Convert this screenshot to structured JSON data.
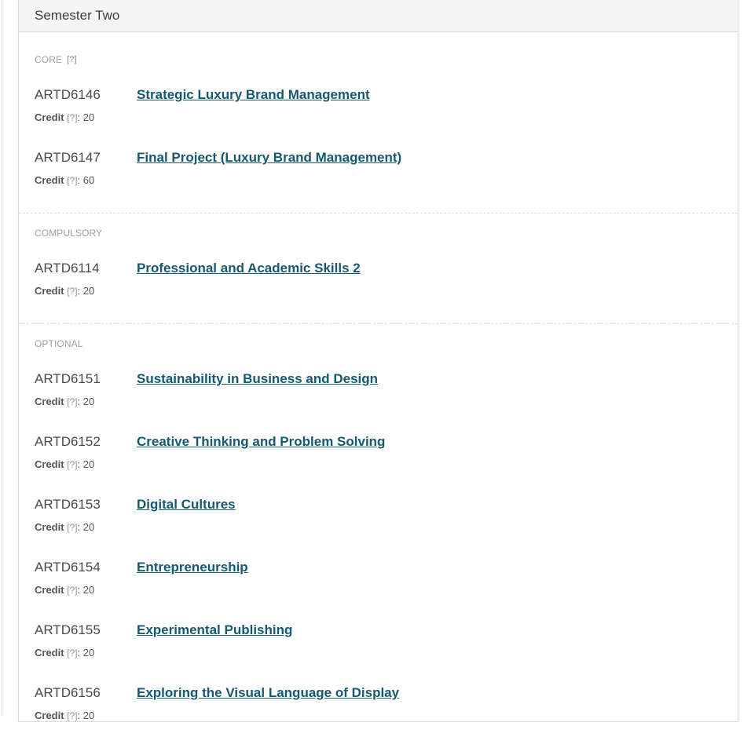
{
  "panel": {
    "title": "Semester Two"
  },
  "credit_label": "Credit",
  "help_marker": "[?]",
  "groups": [
    {
      "label": "CORE",
      "show_help": true,
      "modules": [
        {
          "code": "ARTD6146",
          "title": "Strategic Luxury Brand Management",
          "credit": ": 20"
        },
        {
          "code": "ARTD6147",
          "title": "Final Project (Luxury Brand Management)",
          "credit": ": 60"
        }
      ]
    },
    {
      "label": "COMPULSORY",
      "show_help": false,
      "modules": [
        {
          "code": "ARTD6114",
          "title": "Professional and Academic Skills 2",
          "credit": ": 20"
        }
      ]
    },
    {
      "label": "OPTIONAL",
      "show_help": false,
      "modules": [
        {
          "code": "ARTD6151",
          "title": "Sustainability in Business and Design",
          "credit": ": 20"
        },
        {
          "code": "ARTD6152",
          "title": "Creative Thinking and Problem Solving",
          "credit": ": 20"
        },
        {
          "code": "ARTD6153",
          "title": "Digital Cultures",
          "credit": ": 20"
        },
        {
          "code": "ARTD6154",
          "title": "Entrepreneurship",
          "credit": ": 20"
        },
        {
          "code": "ARTD6155",
          "title": "Experimental Publishing",
          "credit": ": 20"
        },
        {
          "code": "ARTD6156",
          "title": "Exploring the Visual Language of Display",
          "credit": ": 20"
        }
      ]
    }
  ]
}
